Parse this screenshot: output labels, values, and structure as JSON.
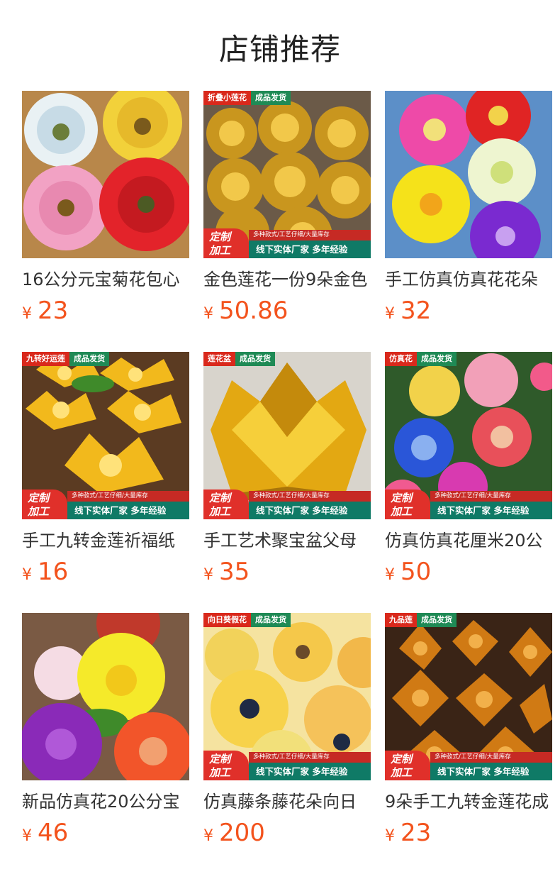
{
  "header": {
    "title": "店铺推荐"
  },
  "currency_symbol": "¥",
  "products": [
    {
      "title": "16公分元宝菊花包心",
      "price": "23",
      "tags": [],
      "has_banner": false,
      "image": "pastel-chrysanthemums-icon"
    },
    {
      "title": "金色莲花一份9朵金色",
      "price": "50.86",
      "tags": [
        "折叠小莲花",
        "成品发货"
      ],
      "has_banner": true,
      "image": "gold-folded-lotus-icon"
    },
    {
      "title": "手工仿真仿真花花朵",
      "price": "32",
      "tags": [],
      "has_banner": false,
      "image": "artificial-flower-heads-icon"
    },
    {
      "title": "手工九转金莲祈福纸",
      "price": "16",
      "tags": [
        "九转好运莲",
        "成品发货"
      ],
      "has_banner": true,
      "image": "gold-paper-lotus-icon"
    },
    {
      "title": "手工艺术聚宝盆父母",
      "price": "35",
      "tags": [
        "莲花盆",
        "成品发货"
      ],
      "has_banner": true,
      "image": "gold-treasure-bowl-icon"
    },
    {
      "title": "仿真仿真花厘米20公",
      "price": "50",
      "tags": [
        "仿真花",
        "成品发货"
      ],
      "has_banner": true,
      "image": "colorful-peonies-icon"
    },
    {
      "title": "新品仿真花20公分宝",
      "price": "46",
      "tags": [],
      "has_banner": false,
      "image": "bright-lotus-flowers-icon"
    },
    {
      "title": "仿真藤条藤花朵向日",
      "price": "200",
      "tags": [
        "向日葵假花",
        "成品发货"
      ],
      "has_banner": true,
      "image": "sunflower-heads-icon"
    },
    {
      "title": "9朵手工九转金莲花成",
      "price": "23",
      "tags": [
        "九品莲",
        "成品发货"
      ],
      "has_banner": true,
      "image": "amber-foil-lotus-icon"
    }
  ],
  "banner": {
    "badge_line1": "定制",
    "badge_line2": "加工",
    "small_text": "多种款式/工艺仔细/大量库存",
    "main_text": "线下实体厂家  多年经验"
  },
  "colors": {
    "price": "#f3531d",
    "tag_red": "#d9291c",
    "tag_green": "#1f8a55",
    "banner_teal": "#0f7a66"
  }
}
